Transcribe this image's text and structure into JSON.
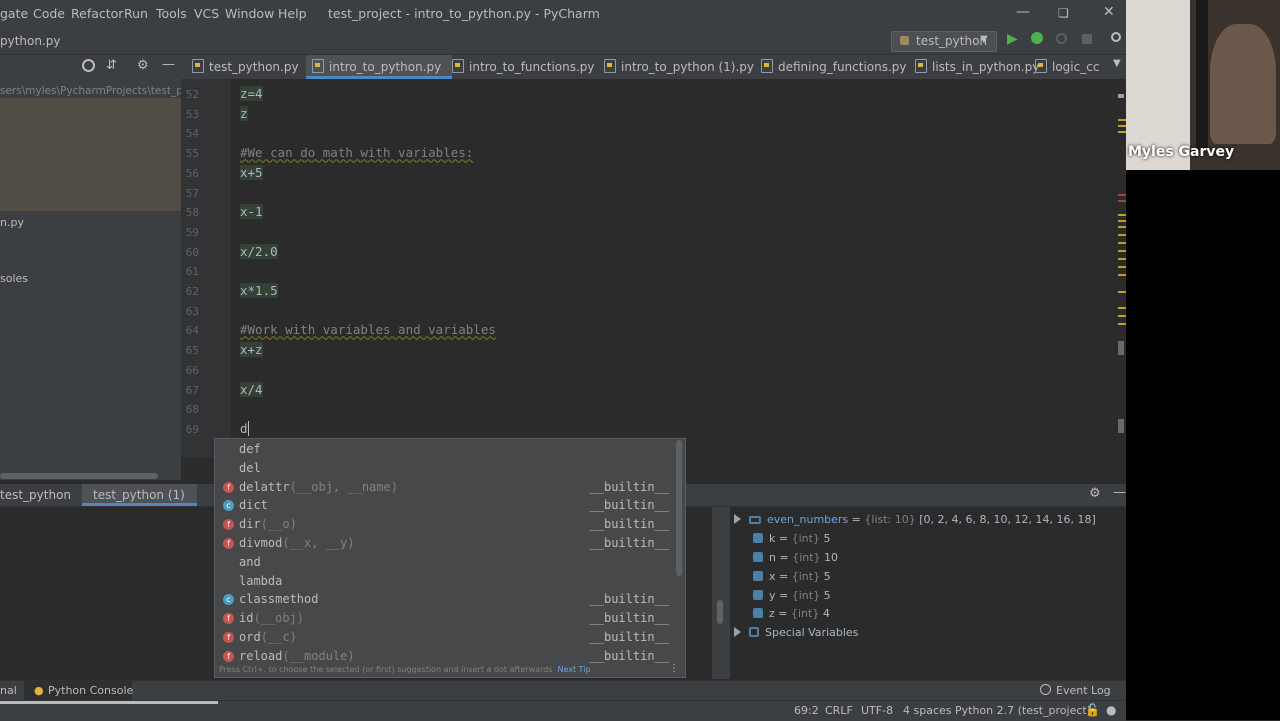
{
  "menubar": {
    "items": [
      "gate",
      "Code",
      "Refactor",
      "Run",
      "Tools",
      "VCS",
      "Window",
      "Help"
    ],
    "title": "test_project - intro_to_python.py - PyCharm"
  },
  "navbar": {
    "breadcrumb": "python.py",
    "run_config": "test_python"
  },
  "tabs": [
    "test_python.py",
    "intro_to_python.py",
    "intro_to_functions.py",
    "intro_to_python (1).py",
    "defining_functions.py",
    "lists_in_python.py",
    "logic_cc"
  ],
  "project_panel": {
    "path": "sers\\myles\\PycharmProjects\\test_pro",
    "item_py": "n.py",
    "item_consoles": "soles"
  },
  "editor": {
    "lines": [
      {
        "n": "52",
        "text": "z=4"
      },
      {
        "n": "53",
        "text": "z"
      },
      {
        "n": "54",
        "text": ""
      },
      {
        "n": "55",
        "text": "#We can do math with variables:"
      },
      {
        "n": "56",
        "text": "x+5"
      },
      {
        "n": "57",
        "text": ""
      },
      {
        "n": "58",
        "text": "x-1"
      },
      {
        "n": "59",
        "text": ""
      },
      {
        "n": "60",
        "text": "x/2.0"
      },
      {
        "n": "61",
        "text": ""
      },
      {
        "n": "62",
        "text": "x*1.5"
      },
      {
        "n": "63",
        "text": ""
      },
      {
        "n": "64",
        "text": "#Work with variables and variables"
      },
      {
        "n": "65",
        "text": "x+z"
      },
      {
        "n": "66",
        "text": ""
      },
      {
        "n": "67",
        "text": "x/4"
      },
      {
        "n": "68",
        "text": ""
      },
      {
        "n": "69",
        "text": "d"
      }
    ]
  },
  "completion": {
    "items": [
      {
        "icon": "",
        "name": "def",
        "args": "",
        "src": ""
      },
      {
        "icon": "",
        "name": "del",
        "args": "",
        "src": ""
      },
      {
        "icon": "f",
        "name": "delattr",
        "args": "(__obj, __name)",
        "src": "__builtin__"
      },
      {
        "icon": "c",
        "name": "dict",
        "args": "",
        "src": "__builtin__"
      },
      {
        "icon": "f",
        "name": "dir",
        "args": "(__o)",
        "src": "__builtin__"
      },
      {
        "icon": "f",
        "name": "divmod",
        "args": "(__x, __y)",
        "src": "__builtin__"
      },
      {
        "icon": "",
        "name": "and",
        "args": "",
        "src": ""
      },
      {
        "icon": "",
        "name": "lambda",
        "args": "",
        "src": ""
      },
      {
        "icon": "c",
        "name": "classmethod",
        "args": "",
        "src": "__builtin__"
      },
      {
        "icon": "f",
        "name": "id",
        "args": "(__obj)",
        "src": "__builtin__"
      },
      {
        "icon": "f",
        "name": "ord",
        "args": "(__c)",
        "src": "__builtin__"
      },
      {
        "icon": "f",
        "name": "reload",
        "args": "(__module)",
        "src": "__builtin__"
      }
    ],
    "hint": "Press Ctrl+. to choose the selected (or first) suggestion and insert a dot afterwards",
    "next_tip": "Next Tip"
  },
  "console": {
    "tabs": [
      "test_python",
      "test_python (1)"
    ]
  },
  "variables": [
    {
      "name": "even_numbers",
      "type": "{list: 10}",
      "value": "[0, 2, 4, 6, 8, 10, 12, 14, 16, 18]",
      "expandable": true
    },
    {
      "name": "k",
      "type": "{int}",
      "value": "5"
    },
    {
      "name": "n",
      "type": "{int}",
      "value": "10"
    },
    {
      "name": "x",
      "type": "{int}",
      "value": "5"
    },
    {
      "name": "y",
      "type": "{int}",
      "value": "5"
    },
    {
      "name": "z",
      "type": "{int}",
      "value": "4"
    },
    {
      "name": "Special Variables",
      "type": "",
      "value": "",
      "expandable": true
    }
  ],
  "toolwindows": {
    "left_partial": "nal",
    "python_console": "Python Console",
    "event_log": "Event Log"
  },
  "status": {
    "position": "69:2",
    "line_sep": "CRLF",
    "encoding": "UTF-8",
    "indent": "4 spaces",
    "interpreter": "Python 2.7 (test_project)"
  },
  "webcam": {
    "name": "Myles Garvey"
  },
  "colors": {
    "accent": "#4a88c7",
    "run_green": "#4caf50",
    "highlight_bg": "#344134"
  }
}
